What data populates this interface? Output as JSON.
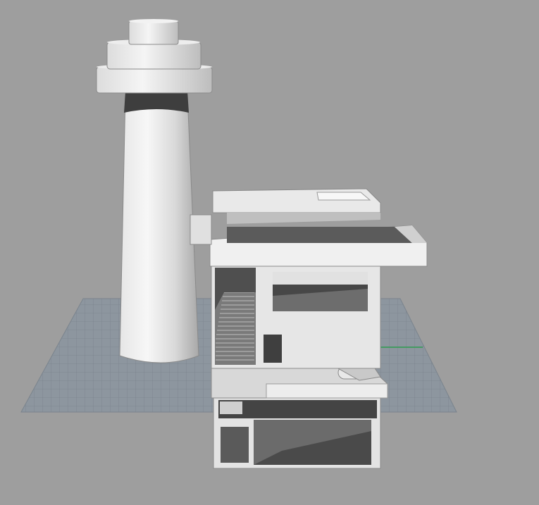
{
  "viewport": {
    "background_color": "#9e9e9e",
    "grid_color": "#8b949e",
    "grid_line_color": "#7d8690",
    "axis_x_color": "#c0392b",
    "axis_y_color": "#27ae60",
    "model_light": "#f4f4f4",
    "model_mid": "#d6d6d6",
    "model_shadow": "#5a5a5a",
    "model_dark": "#3f3f3f"
  },
  "scene": {
    "objects": [
      "tower",
      "building"
    ]
  }
}
